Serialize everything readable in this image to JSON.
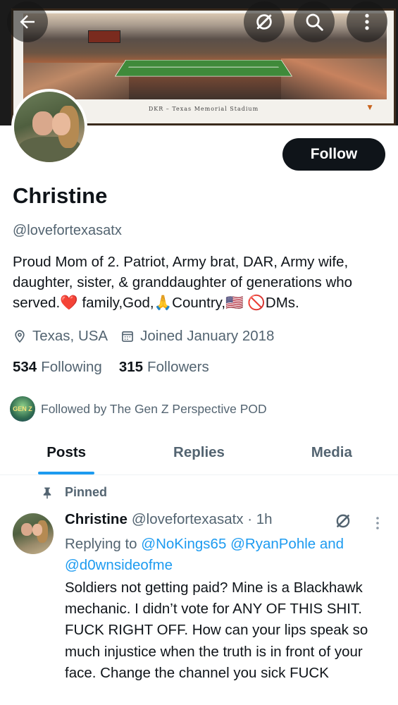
{
  "banner": {
    "caption": "DKR – Texas Memorial Stadium",
    "buttons": {
      "back": "back-arrow-icon",
      "grok": "grok-icon",
      "search": "search-icon",
      "more": "more-vertical-icon"
    }
  },
  "profile": {
    "name": "Christine",
    "handle": "@lovefortexasatx",
    "follow_label": "Follow",
    "bio": {
      "part1": "Proud Mom of 2. Patriot, Army brat, DAR, Army wife, daughter, sister, & granddaughter of generations who served.",
      "heart": "❤️",
      "part2": " family,God,",
      "pray": "🙏",
      "part3": "Country,",
      "flag": "🇺🇸",
      "part4": " ",
      "no": "🚫",
      "part5": "DMs."
    },
    "location": "Texas, USA",
    "joined": "Joined January 2018",
    "following_count": "534",
    "following_label": "Following",
    "followers_count": "315",
    "followers_label": "Followers",
    "followed_by": "Followed by The Gen Z Perspective POD",
    "followed_by_avatar_text": "GEN Z"
  },
  "tabs": [
    {
      "label": "Posts",
      "active": true
    },
    {
      "label": "Replies",
      "active": false
    },
    {
      "label": "Media",
      "active": false
    }
  ],
  "post": {
    "pinned_label": "Pinned",
    "author_name": "Christine",
    "author_handle": "@lovefortexasatx · 1h",
    "replying_prefix": "Replying to ",
    "mention1": "@NoKings65",
    "mention2": "@RyanPohle",
    "and": " and ",
    "mention3": "@d0wnsideofme",
    "text": "Soldiers not getting paid? Mine is a Blackhawk mechanic. I didn’t vote for ANY OF THIS SHIT. FUCK RIGHT OFF. How can your lips speak so much injustice when the truth is in front of your face. Change the channel you sick FUCK"
  },
  "colors": {
    "accent": "#1d9bf0",
    "text": "#0f1419",
    "secondary": "#536471",
    "follow_bg": "#0f1419"
  }
}
